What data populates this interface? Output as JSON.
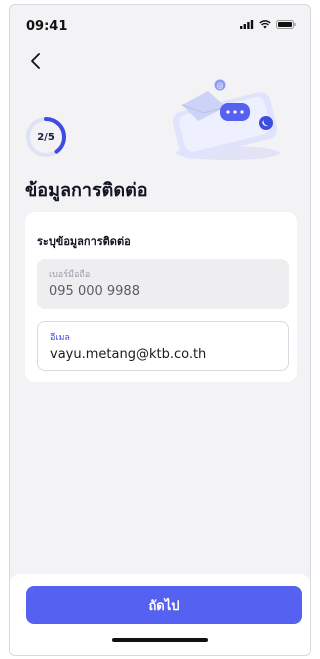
{
  "status_bar": {
    "time": "09:41"
  },
  "progress": {
    "label": "2/5",
    "current": 2,
    "total": 5
  },
  "header": {
    "title": "ข้อมูลการติดต่อ"
  },
  "card": {
    "title": "ระบุข้อมูลการติดต่อ",
    "phone": {
      "label": "เบอร์มือถือ",
      "value": "095 000 9988"
    },
    "email": {
      "label": "อีเมล",
      "value": "vayu.metang@ktb.co.th"
    }
  },
  "footer": {
    "next_label": "ถัดไป"
  },
  "colors": {
    "accent": "#5561f0",
    "background": "#f3f3f6",
    "active_label": "#3e4de0"
  },
  "icons": [
    "signal-icon",
    "wifi-icon",
    "battery-icon",
    "back-arrow-icon",
    "contact-illustration"
  ]
}
